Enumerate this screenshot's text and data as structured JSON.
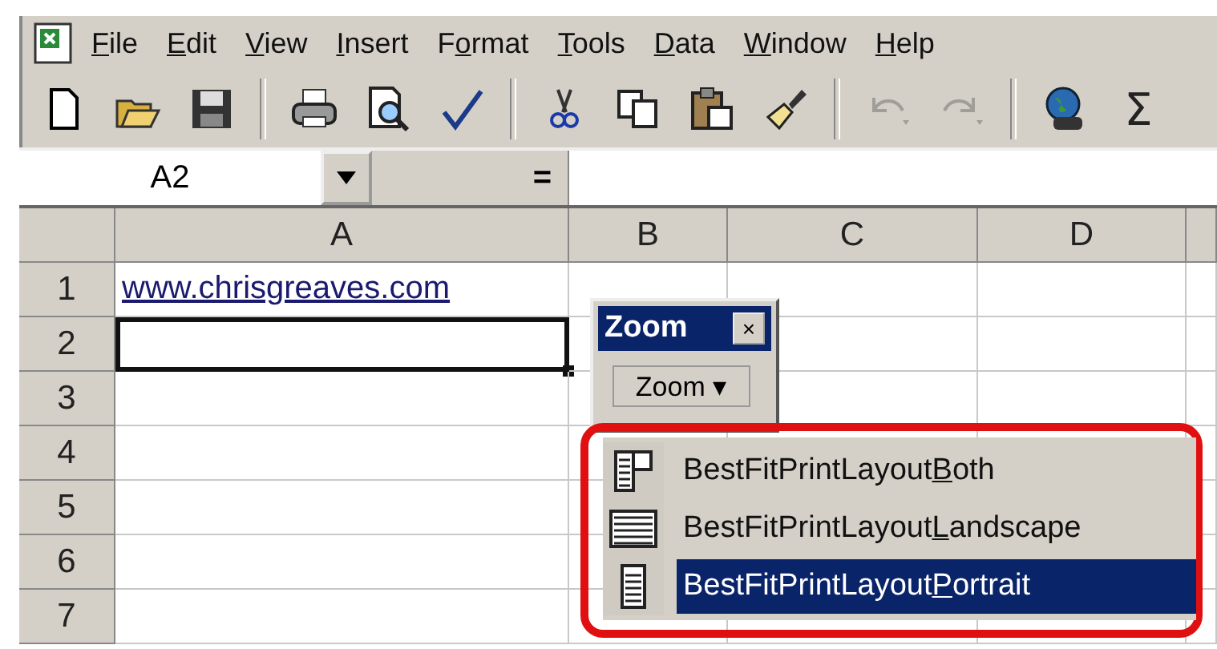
{
  "menu_bar": [
    {
      "key": "F",
      "after": "ile"
    },
    {
      "key": "E",
      "after": "dit"
    },
    {
      "key": "V",
      "after": "iew"
    },
    {
      "key": "I",
      "after": "nsert"
    },
    {
      "before": "F",
      "key": "o",
      "after": "rmat"
    },
    {
      "key": "T",
      "after": "ools"
    },
    {
      "key": "D",
      "after": "ata"
    },
    {
      "key": "W",
      "after": "indow"
    },
    {
      "key": "H",
      "after": "elp"
    }
  ],
  "toolbar_groups": [
    {
      "tools": [
        {
          "kind": "new",
          "disabled": false
        },
        {
          "kind": "open",
          "disabled": false
        },
        {
          "kind": "save",
          "disabled": false
        }
      ]
    },
    {
      "tools": [
        {
          "kind": "print",
          "disabled": false
        },
        {
          "kind": "preview",
          "disabled": false
        },
        {
          "kind": "spelling",
          "disabled": false
        }
      ]
    },
    {
      "tools": [
        {
          "kind": "cut",
          "disabled": false
        },
        {
          "kind": "copy",
          "disabled": false
        },
        {
          "kind": "paste",
          "disabled": false
        },
        {
          "kind": "painter",
          "disabled": false
        }
      ]
    },
    {
      "tools": [
        {
          "kind": "undo",
          "disabled": true
        },
        {
          "kind": "redo",
          "disabled": true
        }
      ]
    },
    {
      "tools": [
        {
          "kind": "globe",
          "disabled": false
        },
        {
          "kind": "glyph",
          "text": "Σ",
          "disabled": false
        }
      ]
    }
  ],
  "formula_bar": {
    "name_box": "A2",
    "equals": "="
  },
  "columns": [
    "A",
    "B",
    "C",
    "D"
  ],
  "rows": [
    {
      "number": "1",
      "selected": false,
      "link": "www.chrisgreaves.com"
    },
    {
      "number": "2",
      "selected": true
    },
    {
      "number": "3",
      "selected": false
    },
    {
      "number": "4",
      "selected": false
    },
    {
      "number": "5",
      "selected": false
    },
    {
      "number": "6",
      "selected": false
    },
    {
      "number": "7",
      "selected": false
    }
  ],
  "zoom_toolbar": {
    "title": "Zoom",
    "close": "×",
    "button": "Zoom ▾"
  },
  "zoom_menu": [
    {
      "before": "BestFitPrintLayout",
      "key": "B",
      "after": "oth",
      "kind": "both",
      "selected": false
    },
    {
      "before": "BestFitPrintLayout",
      "key": "L",
      "after": "andscape",
      "kind": "landscape",
      "selected": false
    },
    {
      "before": "BestFitPrintLayout",
      "key": "P",
      "after": "ortrait",
      "kind": "portrait",
      "selected": true
    }
  ]
}
